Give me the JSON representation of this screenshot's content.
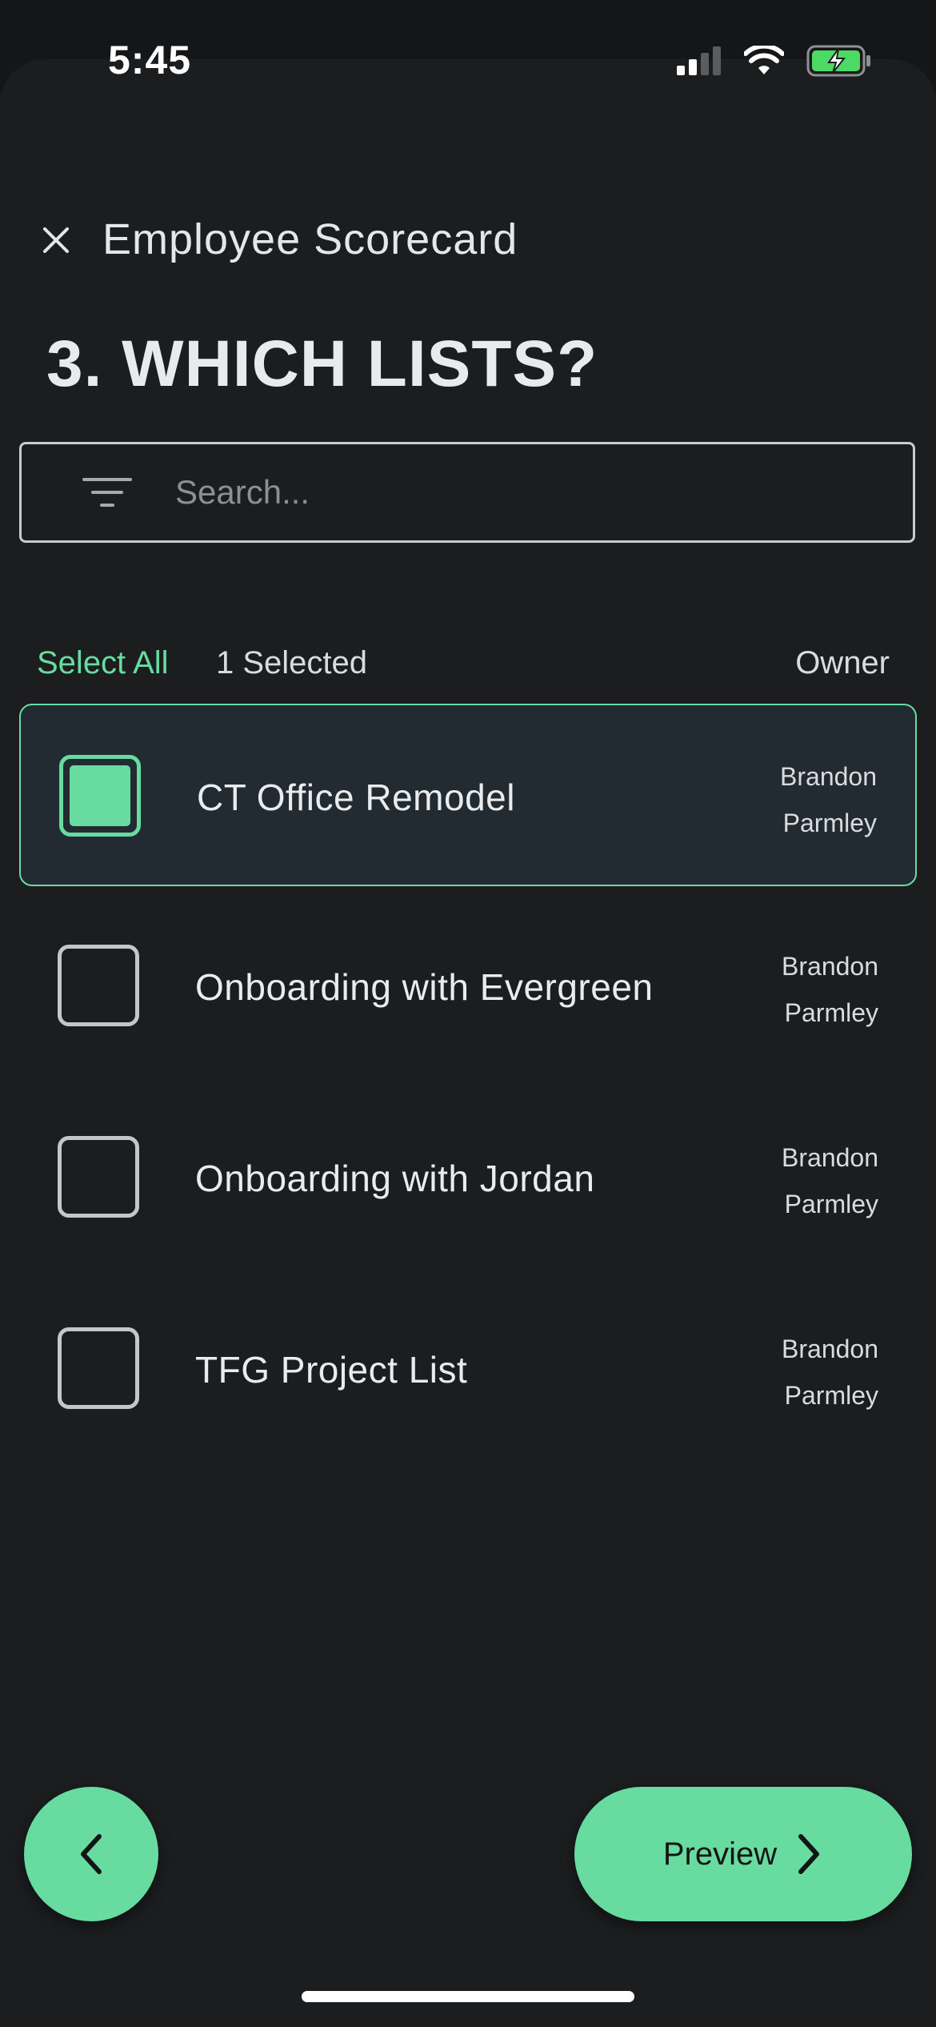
{
  "status_bar": {
    "time": "5:45"
  },
  "header": {
    "title": "Employee Scorecard",
    "step_title": "3. WHICH LISTS?"
  },
  "search": {
    "placeholder": "Search...",
    "value": ""
  },
  "list_header": {
    "select_all": "Select All",
    "selected_count": "1 Selected",
    "owner_label": "Owner"
  },
  "lists": [
    {
      "name": "CT Office Remodel",
      "owner_first": "Brandon",
      "owner_last": "Parmley",
      "selected": true
    },
    {
      "name": "Onboarding with Evergreen",
      "owner_first": "Brandon",
      "owner_last": "Parmley",
      "selected": false
    },
    {
      "name": "Onboarding with Jordan",
      "owner_first": "Brandon",
      "owner_last": "Parmley",
      "selected": false
    },
    {
      "name": "TFG Project List",
      "owner_first": "Brandon",
      "owner_last": "Parmley",
      "selected": false
    }
  ],
  "footer": {
    "preview_label": "Preview"
  },
  "colors": {
    "accent": "#68dca0",
    "background": "#1b1d1f",
    "selected_row": "#222b32"
  },
  "icons": [
    "close-icon",
    "filter-icon",
    "chevron-left-icon",
    "chevron-right-icon",
    "signal-icon",
    "wifi-icon",
    "battery-charging-icon"
  ]
}
